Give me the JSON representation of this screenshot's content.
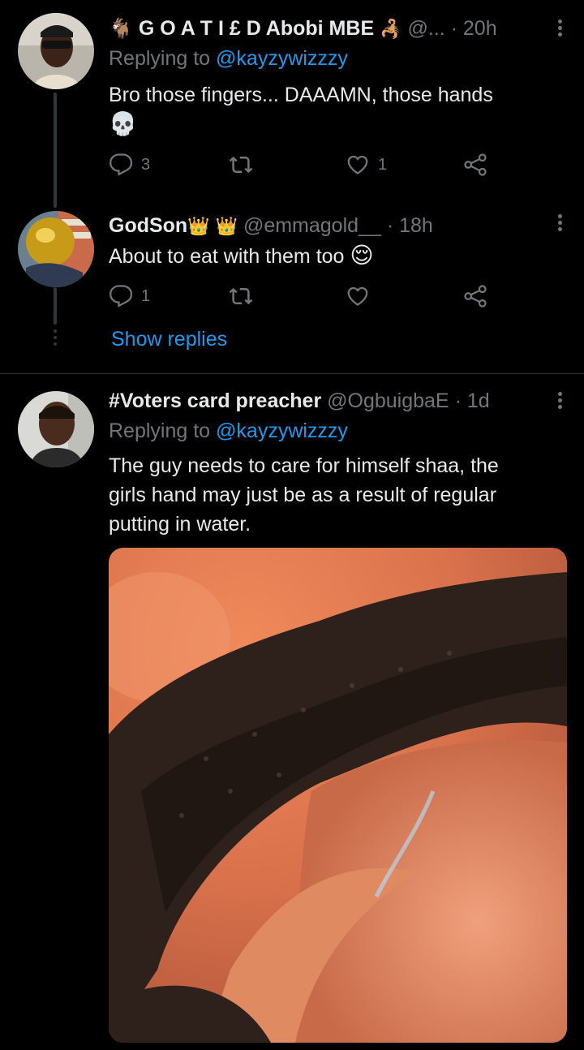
{
  "tweets": [
    {
      "display_name": "G O A T I £ D Abobi MBE",
      "goat_glyph": "🐐",
      "scorpion_glyph": "🦂",
      "handle": "@...",
      "time": "· 20h",
      "reply_label": "Replying to",
      "reply_handle": "@kayzywizzzy",
      "text": "Bro those fingers... DAAAMN, those hands",
      "emoji": "💀",
      "reply_count": "3",
      "retweet_count": "",
      "like_count": "1"
    },
    {
      "display_name": "GodSon",
      "crown_glyph": "👑",
      "handle": "@emmagold__",
      "time": "· 18h",
      "text": "About to eat with them too",
      "emoji": "😌",
      "reply_count": "1",
      "retweet_count": "",
      "like_count": ""
    },
    {
      "display_name": "#Voters card preacher",
      "handle": "@OgbuigbaE",
      "time": "· 1d",
      "reply_label": "Replying to",
      "reply_handle": "@kayzywizzzy",
      "text_lines": [
        "The guy needs to care for himself shaa, the",
        "girls hand may just be as a result of regular",
        "putting in water."
      ]
    }
  ],
  "show_replies_label": "Show replies",
  "colors": {
    "background": "#000000",
    "text": "#e7e9ea",
    "muted": "#71767b",
    "link": "#1d9bf0",
    "divider": "#2f3336"
  },
  "icons": [
    "reply-icon",
    "retweet-icon",
    "like-icon",
    "share-icon",
    "more-icon",
    "skull-emoji",
    "relieved-face-emoji",
    "crown-emoji"
  ]
}
